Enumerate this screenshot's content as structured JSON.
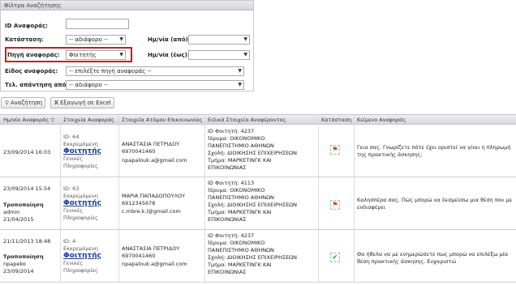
{
  "filters": {
    "title": "Φίλτρα Αναζήτησης",
    "id_label": "ID Αναφοράς:",
    "status_label": "Κατάσταση:",
    "status_value": "-- αδιάφορο --",
    "source_label": "Πηγή αναφοράς:",
    "source_value": "Φοιτητής",
    "type_label": "Είδος αναφοράς:",
    "type_value": "-- επιλέξτε πηγή αναφοράς --",
    "last_reply_label": "Τελ. απάντηση από:",
    "last_reply_value": "-- αδιάφορο --",
    "date_from_label": "Ημ/νία (από):",
    "date_to_label": "Ημ/νία (έως):"
  },
  "toolbar": {
    "search_label": "Αναζήτηση",
    "export_label": "Εξαγωγή σε Excel"
  },
  "table": {
    "headers": {
      "date": "Ημ/νία Αναφοράς ▽",
      "report": "Στοιχεία Αναφοράς",
      "contact": "Στοιχεία Ατόμου Επικοινωνίας",
      "special": "Ειδικά Στοιχεία Αναφέροντος",
      "status": "Κατάσταση",
      "text": "Κείμενο Αναφοράς"
    },
    "rows": [
      {
        "date": "23/09/2014 16:03",
        "edit_label": "",
        "edit_user": "",
        "edit_date": "",
        "id": "ID: 64",
        "state": "Εκκρεμόμενη",
        "source": "Φοιτητής",
        "cat1": "Γενικές",
        "cat2": "Πληροφορίες",
        "contact_name": "ΑΝΑΣΤΑΣΙΑ ΠΕΤΡΙΔΟΥ",
        "contact_phone": "6970041460",
        "contact_email": "npapalouk.a@gmail.com",
        "student_id": "ID Φοιτητή: 4237",
        "institution": "Ίδρυμα: ΟΙΚΟΝΟΜΙΚΟ",
        "institution2": "ΠΑΝΕΠΙΣΤΗΜΙΟ ΑΘΗΝΩΝ",
        "school": "Σχολή: ΔΙΟΙΚΗΣΗΣ ΕΠΙΧΕΙΡΗΣΕΩΝ",
        "dept": "Τμήμα: ΜΑΡΚΕΤΙΝΓΚ ΚΑΙ",
        "dept2": "ΕΠΙΚΟΙΝΩΝΙΑΣ",
        "status_icon": "flag-icon",
        "message": "Γεια σας. Γνωρίζετε πότε έχει οριστεί να γίνει η πληρωμή της πρακτικής άσκησης;"
      },
      {
        "date": "23/09/2014 15:54",
        "edit_label": "Τροποποίηση",
        "edit_user": "admin",
        "edit_date": "21/04/2015",
        "id": "ID: 63",
        "state": "Εκκρεμόμενη",
        "source": "Φοιτητής",
        "cat1": "Γενικές",
        "cat2": "Πληροφορίες",
        "contact_name": "ΜΑΡΙΑ ΠΑΠΑΔΟΠΟΥΛΟΥ",
        "contact_phone": "6912345678",
        "contact_email": "c.mbre.k.l@gmail.com",
        "student_id": "ID Φοιτητή: 4113",
        "institution": "Ίδρυμα: ΟΙΚΟΝΟΜΙΚΟ",
        "institution2": "ΠΑΝΕΠΙΣΤΗΜΙΟ ΑΘΗΝΩΝ",
        "school": "Σχολή: ΔΙΟΙΚΗΣΗΣ ΕΠΙΧΕΙΡΗΣΕΩΝ",
        "dept": "Τμήμα: ΜΑΡΚΕΤΙΝΓΚ ΚΑΙ",
        "dept2": "ΕΠΙΚΟΙΝΩΝΙΑΣ",
        "status_icon": "flag-icon",
        "message": "Καλησπέρα σας. Πώς μπορώ να δεσμεύσω μια θέση που με ενδιαφέρει"
      },
      {
        "date": "21/11/2013 18:48",
        "edit_label": "Τροποποίηση",
        "edit_user": "npapeko",
        "edit_date": "23/09/2014",
        "id": "ID: 4",
        "state": "Εκκρεμόμενη",
        "source": "Φοιτητής",
        "cat1": "Γενικές",
        "cat2": "Πληροφορίες",
        "contact_name": "ΑΝΑΣΤΑΣΙΑ ΠΕΤΡΙΔΟΥ",
        "contact_phone": "6970041460",
        "contact_email": "npapalouk.a@gmail.com",
        "student_id": "ID Φοιτητή: 4237",
        "institution": "Ίδρυμα: ΟΙΚΟΝΟΜΙΚΟ",
        "institution2": "ΠΑΝΕΠΙΣΤΗΜΙΟ ΑΘΗΝΩΝ",
        "school": "Σχολή: ΔΙΟΙΚΗΣΗΣ ΕΠΙΧΕΙΡΗΣΕΩΝ",
        "dept": "Τμήμα: ΜΑΡΚΕΤΙΝΓΚ ΚΑΙ",
        "dept2": "ΕΠΙΚΟΙΝΩΝΙΑΣ",
        "status_icon": "check-icon",
        "message": "Θα ήθελα να με ενημερώσετε πως μπορώ να επιλέξω μία θέση πρακτικής άσκησης. Ευχαριστώ"
      }
    ]
  }
}
